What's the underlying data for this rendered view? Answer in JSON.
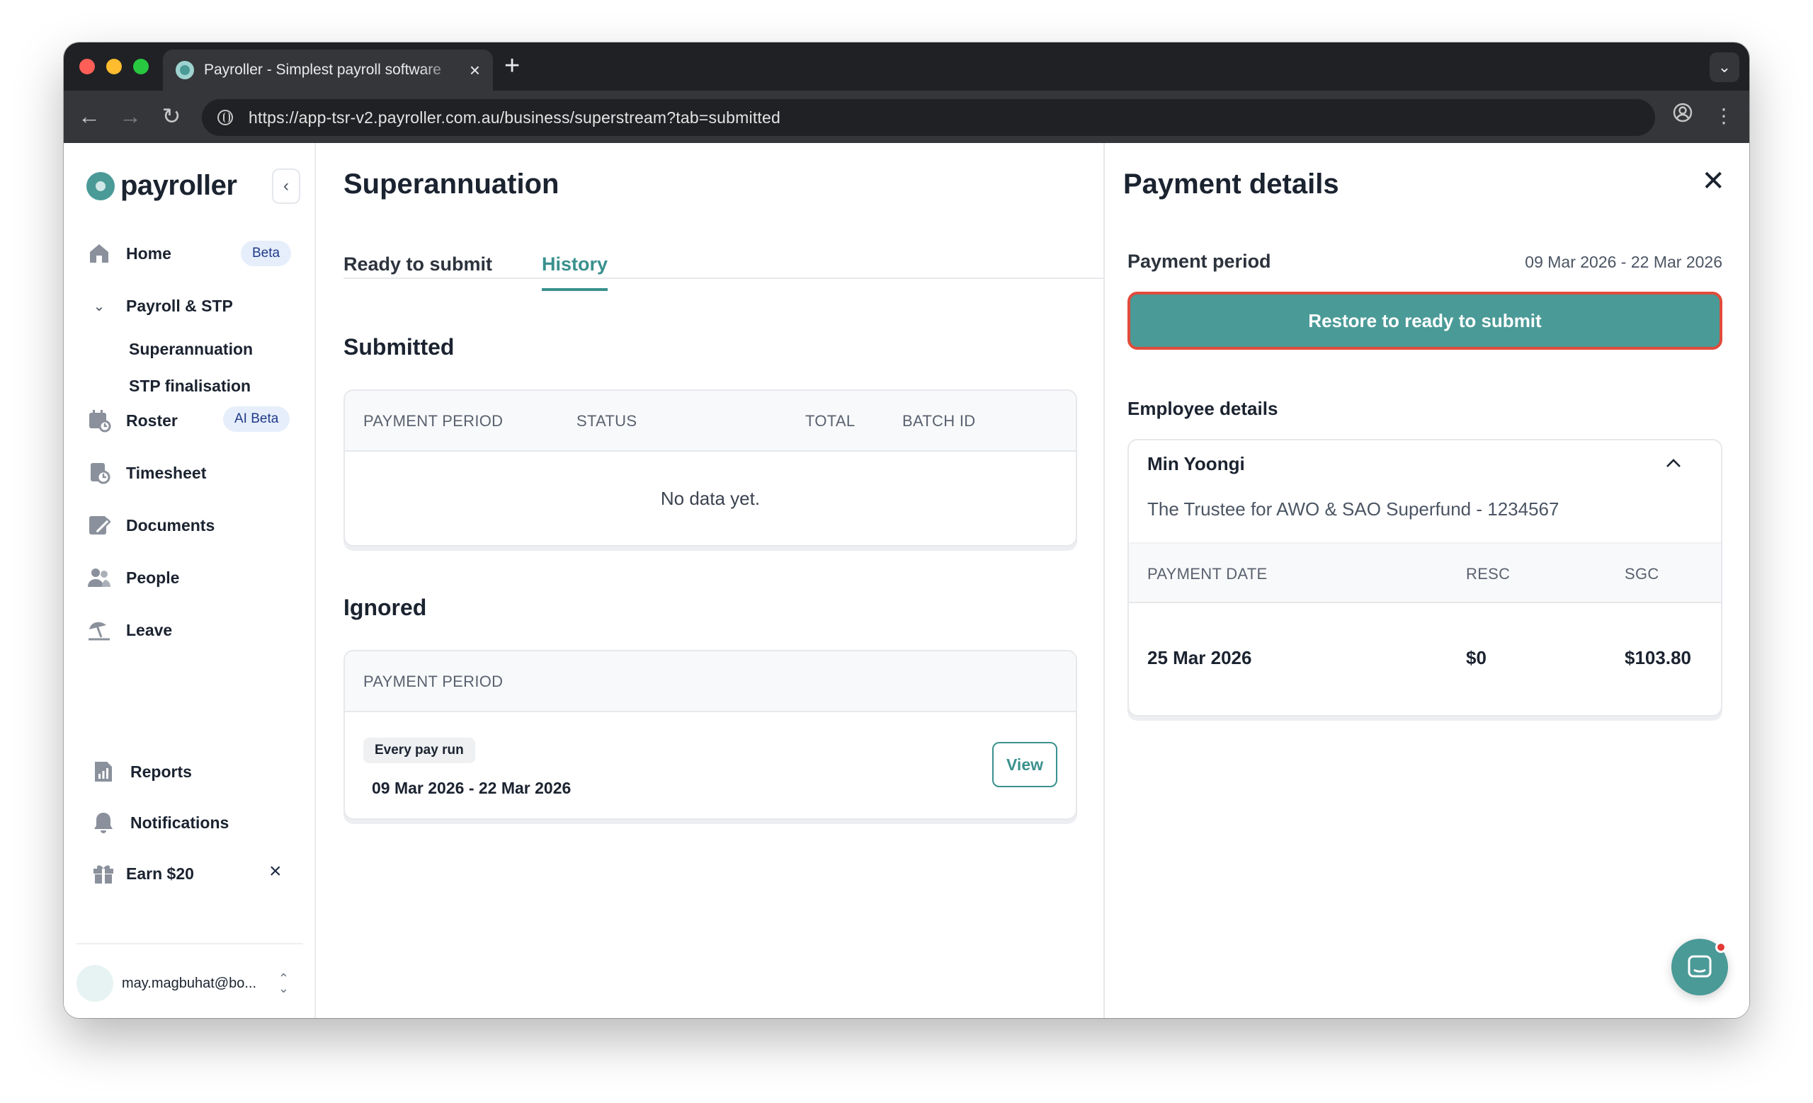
{
  "browser": {
    "tab_title": "Payroller - Simplest payroll software",
    "url": "https://app-tsr-v2.payroller.com.au/business/superstream?tab=submitted"
  },
  "sidebar": {
    "logo": "payroller",
    "items": [
      {
        "label": "Home",
        "icon": "home-icon",
        "badge": "Beta"
      },
      {
        "label": "Payroll & STP",
        "icon": "chevron-down-icon"
      },
      {
        "label": "Superannuation"
      },
      {
        "label": "STP finalisation"
      },
      {
        "label": "Roster",
        "icon": "calendar-icon",
        "badge": "AI Beta"
      },
      {
        "label": "Timesheet",
        "icon": "timesheet-icon"
      },
      {
        "label": "Documents",
        "icon": "documents-icon"
      },
      {
        "label": "People",
        "icon": "people-icon"
      },
      {
        "label": "Leave",
        "icon": "umbrella-icon"
      }
    ],
    "bottom_items": [
      {
        "label": "Reports",
        "icon": "reports-icon"
      },
      {
        "label": "Notifications",
        "icon": "bell-icon"
      },
      {
        "label": "Earn $20",
        "icon": "gift-icon"
      }
    ],
    "user_email": "may.magbuhat@bo..."
  },
  "main": {
    "title": "Superannuation",
    "tabs": [
      {
        "label": "Ready to submit",
        "active": false
      },
      {
        "label": "History",
        "active": true
      }
    ],
    "submitted": {
      "title": "Submitted",
      "columns": [
        "PAYMENT PERIOD",
        "STATUS",
        "TOTAL",
        "BATCH ID"
      ],
      "empty_text": "No data yet."
    },
    "ignored": {
      "title": "Ignored",
      "columns": [
        "PAYMENT PERIOD"
      ],
      "rows": [
        {
          "frequency": "Every pay run",
          "period": "09 Mar 2026 - 22 Mar 2026",
          "action": "View"
        }
      ]
    }
  },
  "panel": {
    "title": "Payment details",
    "payment_period_label": "Payment period",
    "payment_period_value": "09 Mar 2026 - 22 Mar 2026",
    "restore_button": "Restore to ready to submit",
    "employee_details_title": "Employee details",
    "employee": {
      "name": "Min Yoongi",
      "fund": "The Trustee for AWO & SAO Superfund - 1234567",
      "columns": [
        "PAYMENT DATE",
        "RESC",
        "SGC"
      ],
      "row": {
        "payment_date": "25 Mar 2026",
        "resc": "$0",
        "sgc": "$103.80"
      }
    }
  },
  "colors": {
    "brand": "#4a9a97",
    "active_tab": "#3a918e",
    "highlight_border": "#e04b3a",
    "badge_bg": "#e6eefb"
  }
}
